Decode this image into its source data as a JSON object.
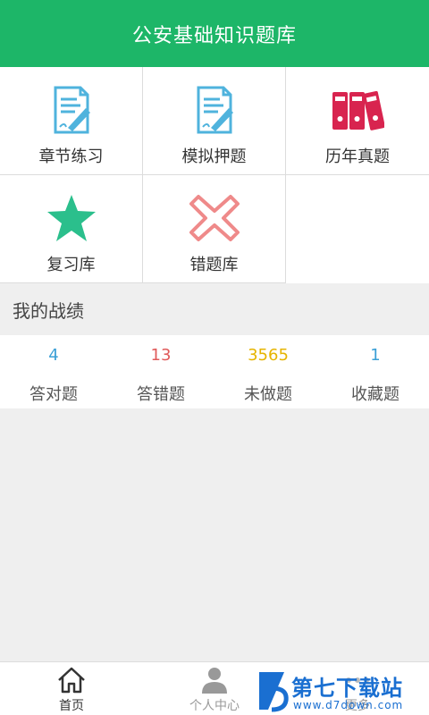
{
  "header": {
    "title": "公安基础知识题库"
  },
  "menu": [
    {
      "label": "章节练习",
      "icon": "document-pencil-icon"
    },
    {
      "label": "模拟押题",
      "icon": "document-pencil-icon"
    },
    {
      "label": "历年真题",
      "icon": "binders-icon"
    },
    {
      "label": "复习库",
      "icon": "star-icon"
    },
    {
      "label": "错题库",
      "icon": "cross-icon"
    }
  ],
  "record": {
    "title": "我的战绩",
    "stats": [
      {
        "value": "4",
        "label": "答对题",
        "color": "#3a9fd6"
      },
      {
        "value": "13",
        "label": "答错题",
        "color": "#e05a5a"
      },
      {
        "value": "3565",
        "label": "未做题",
        "color": "#e6b400"
      },
      {
        "value": "1",
        "label": "收藏题",
        "color": "#3a9fd6"
      }
    ]
  },
  "tabs": [
    {
      "label": "首页",
      "icon": "home-icon",
      "active": true
    },
    {
      "label": "个人中心",
      "icon": "user-icon",
      "active": false
    },
    {
      "label": "更多",
      "icon": "more-icon",
      "active": false
    }
  ],
  "watermark": {
    "text": "第七下载站",
    "url": "www.d7down.com"
  },
  "colors": {
    "primary": "#1db668",
    "icon_blue": "#4fb3dd",
    "binder_red": "#d8244f",
    "star_green": "#2bbf8c",
    "cross_red": "#ef8a8a"
  }
}
